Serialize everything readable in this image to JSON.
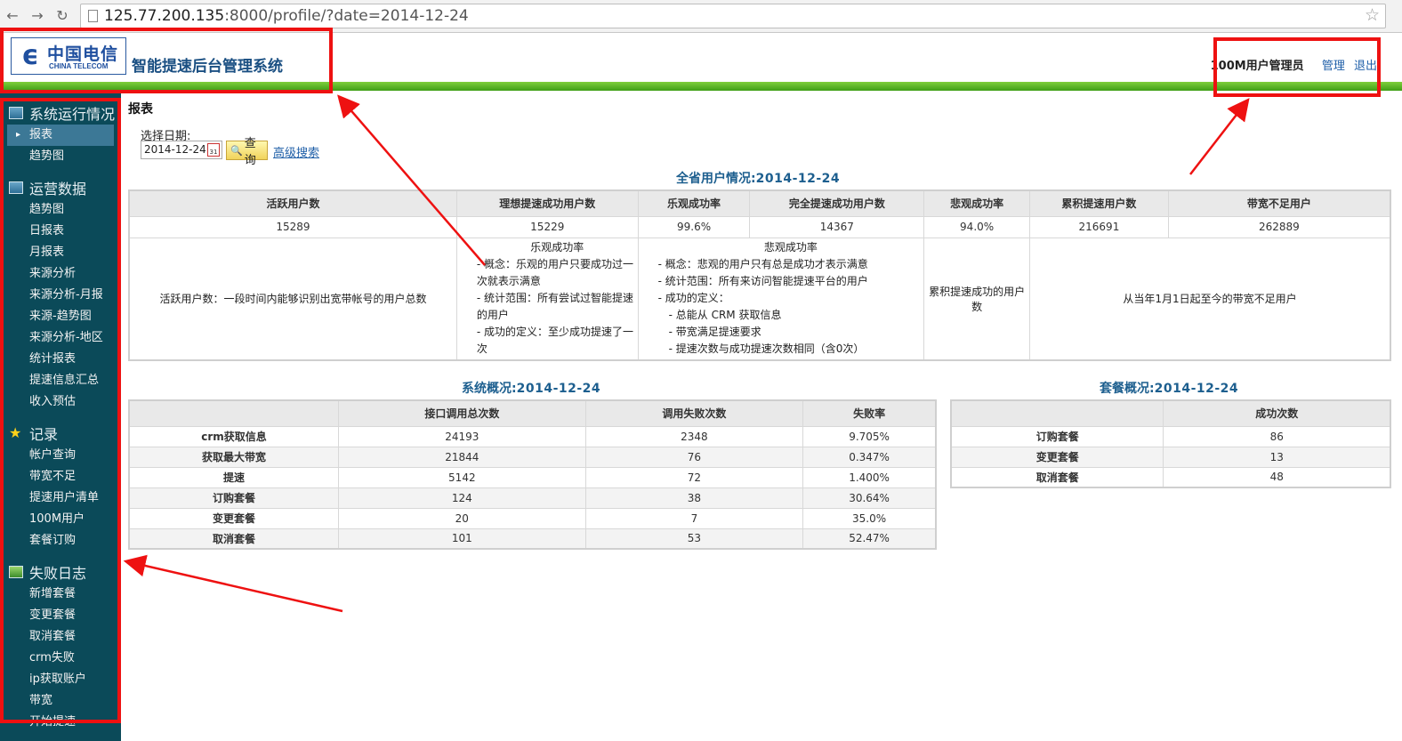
{
  "browser": {
    "url_host": "125.77.200.135",
    "url_rest": ":8000/profile/?date=2014-12-24",
    "back_icon": "arrow-left-icon",
    "forward_icon": "arrow-right-icon",
    "reload_icon": "reload-icon",
    "bookmark_icon": "star-icon"
  },
  "header": {
    "logo_cn": "中国电信",
    "logo_en": "CHINA TELECOM",
    "system_title": "智能提速后台管理系统",
    "user_name": "100M用户管理员",
    "manage_link": "管理",
    "logout_link": "退出"
  },
  "sidebar": {
    "groups": [
      {
        "title": "系统运行情况",
        "icon": "monitor-icon",
        "items": [
          "报表",
          "趋势图"
        ]
      },
      {
        "title": "运营数据",
        "icon": "monitor-icon",
        "items": [
          "趋势图",
          "日报表",
          "月报表",
          "来源分析",
          "来源分析-月报",
          "来源-趋势图",
          "来源分析-地区",
          "统计报表",
          "提速信息汇总",
          "收入预估"
        ]
      },
      {
        "title": "记录",
        "icon": "star-icon",
        "items": [
          "帐户查询",
          "带宽不足",
          "提速用户清单",
          "100M用户",
          "套餐订购"
        ]
      },
      {
        "title": "失败日志",
        "icon": "chart-icon",
        "items": [
          "新增套餐",
          "变更套餐",
          "取消套餐",
          "crm失败",
          "ip获取账户",
          "带宽",
          "开始提速"
        ]
      }
    ]
  },
  "main": {
    "page_title": "报表",
    "date_label": "选择日期:",
    "date_value": "2014-12-24",
    "query_button": "查询",
    "advanced_search": "高级搜索",
    "province_title": "全省用户情况:",
    "province_date": "2014-12-24",
    "province_headers": [
      "活跃用户数",
      "理想提速成功用户数",
      "乐观成功率",
      "完全提速成功用户数",
      "悲观成功率",
      "累积提速用户数",
      "带宽不足用户"
    ],
    "province_values": [
      "15289",
      "15229",
      "99.6%",
      "14367",
      "94.0%",
      "216691",
      "262889"
    ],
    "desc_active": "活跃用户数：一段时间内能够识别出宽带帐号的用户总数",
    "desc_opt_title": "乐观成功率",
    "desc_opt_lines": [
      "- 概念：乐观的用户只要成功过一次就表示满意",
      "- 统计范围：所有尝试过智能提速的用户",
      "- 成功的定义：至少成功提速了一次"
    ],
    "desc_pes_title": "悲观成功率",
    "desc_pes_lines": [
      "- 概念：悲观的用户只有总是成功才表示满意",
      "- 统计范围：所有来访问智能提速平台的用户",
      "- 成功的定义：",
      "- 总能从 CRM 获取信息",
      "- 带宽满足提速要求",
      "- 提速次数与成功提速次数相同（含0次）"
    ],
    "desc_cumulative": "累积提速成功的用户数",
    "desc_insufficient": "从当年1月1日起至今的带宽不足用户",
    "system_title": "系统概况:",
    "system_date": "2014-12-24",
    "system_headers": [
      "",
      "接口调用总次数",
      "调用失败次数",
      "失败率"
    ],
    "system_rows": [
      [
        "crm获取信息",
        "24193",
        "2348",
        "9.705%"
      ],
      [
        "获取最大带宽",
        "21844",
        "76",
        "0.347%"
      ],
      [
        "提速",
        "5142",
        "72",
        "1.400%"
      ],
      [
        "订购套餐",
        "124",
        "38",
        "30.64%"
      ],
      [
        "变更套餐",
        "20",
        "7",
        "35.0%"
      ],
      [
        "取消套餐",
        "101",
        "53",
        "52.47%"
      ]
    ],
    "package_title": "套餐概况:",
    "package_date": "2014-12-24",
    "package_headers": [
      "",
      "成功次数"
    ],
    "package_rows": [
      [
        "订购套餐",
        "86"
      ],
      [
        "变更套餐",
        "13"
      ],
      [
        "取消套餐",
        "48"
      ]
    ]
  },
  "colors": {
    "annotation": "#ee1111",
    "sidebar_bg": "#0b4a59",
    "accent_green": "#5ab328",
    "title_blue": "#1d5f8f"
  }
}
